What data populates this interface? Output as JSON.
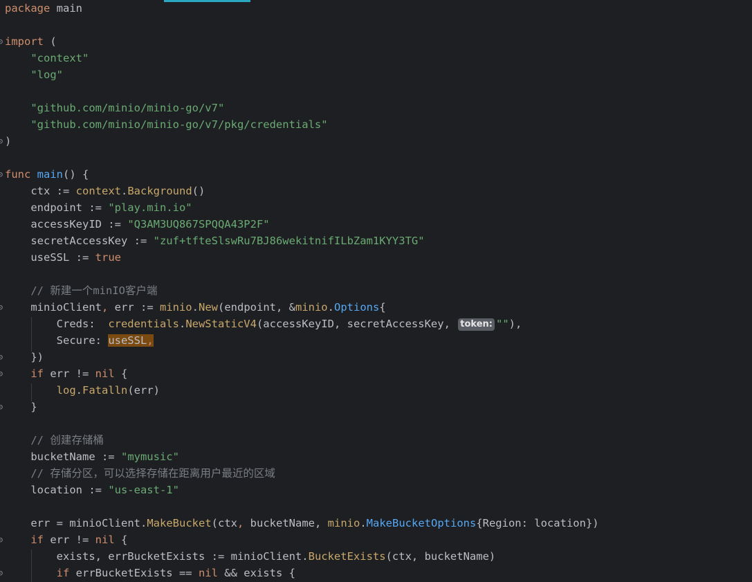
{
  "editor": {
    "lines": [
      [
        {
          "t": "package",
          "c": "kw"
        },
        {
          "t": " main",
          "c": "plain"
        }
      ],
      [],
      [
        {
          "t": "import",
          "c": "kw"
        },
        {
          "t": " (",
          "c": "plain"
        }
      ],
      [
        {
          "t": "    ",
          "c": "plain"
        },
        {
          "t": "\"context\"",
          "c": "str"
        }
      ],
      [
        {
          "t": "    ",
          "c": "plain"
        },
        {
          "t": "\"log\"",
          "c": "str"
        }
      ],
      [],
      [
        {
          "t": "    ",
          "c": "plain"
        },
        {
          "t": "\"github.com/minio/minio-go/v7\"",
          "c": "str"
        }
      ],
      [
        {
          "t": "    ",
          "c": "plain"
        },
        {
          "t": "\"github.com/minio/minio-go/v7/pkg/credentials\"",
          "c": "str"
        }
      ],
      [
        {
          "t": ")",
          "c": "plain"
        }
      ],
      [],
      [
        {
          "t": "func",
          "c": "kw"
        },
        {
          "t": " ",
          "c": "plain"
        },
        {
          "t": "main",
          "c": "fn"
        },
        {
          "t": "() {",
          "c": "plain"
        }
      ],
      [
        {
          "t": "    ctx := ",
          "c": "plain"
        },
        {
          "t": "context",
          "c": "pkgc"
        },
        {
          "t": ".",
          "c": "plain"
        },
        {
          "t": "Background",
          "c": "pkgc"
        },
        {
          "t": "()",
          "c": "plain"
        }
      ],
      [
        {
          "t": "    endpoint := ",
          "c": "plain"
        },
        {
          "t": "\"play.min.io\"",
          "c": "str"
        }
      ],
      [
        {
          "t": "    accessKeyID := ",
          "c": "plain"
        },
        {
          "t": "\"Q3AM3UQ867SPQQA43P2F\"",
          "c": "str"
        }
      ],
      [
        {
          "t": "    secretAccessKey := ",
          "c": "plain"
        },
        {
          "t": "\"zuf+tfteSlswRu7BJ86wekitnifILbZam1KYY3TG\"",
          "c": "str"
        }
      ],
      [
        {
          "t": "    useSSL := ",
          "c": "plain"
        },
        {
          "t": "true",
          "c": "kw"
        }
      ],
      [],
      [
        {
          "t": "    ",
          "c": "plain"
        },
        {
          "t": "// 新建一个minIO客户端",
          "c": "cmt"
        }
      ],
      [
        {
          "t": "    minioClient",
          "c": "plain"
        },
        {
          "t": ",",
          "c": "kw"
        },
        {
          "t": " err := ",
          "c": "plain"
        },
        {
          "t": "minio",
          "c": "pkgc"
        },
        {
          "t": ".",
          "c": "plain"
        },
        {
          "t": "New",
          "c": "pkgc"
        },
        {
          "t": "(endpoint, &",
          "c": "plain"
        },
        {
          "t": "minio",
          "c": "pkgc"
        },
        {
          "t": ".",
          "c": "plain"
        },
        {
          "t": "Options",
          "c": "typ"
        },
        {
          "t": "{",
          "c": "plain"
        }
      ],
      [
        {
          "t": "        Creds:  ",
          "c": "plain"
        },
        {
          "t": "credentials",
          "c": "pkgc"
        },
        {
          "t": ".",
          "c": "plain"
        },
        {
          "t": "NewStaticV4",
          "c": "pkgc"
        },
        {
          "t": "(accessKeyID, secretAccessKey, ",
          "c": "plain"
        },
        {
          "hint": "token:"
        },
        {
          "t": "\"\"",
          "c": "str"
        },
        {
          "t": "),",
          "c": "plain"
        }
      ],
      [
        {
          "t": "        Secure: ",
          "c": "plain"
        },
        {
          "t": "useSSL",
          "c": "plain",
          "hl": true
        },
        {
          "t": ",",
          "c": "kw",
          "hl": true
        }
      ],
      [
        {
          "t": "    })",
          "c": "plain"
        }
      ],
      [
        {
          "t": "    ",
          "c": "plain"
        },
        {
          "t": "if",
          "c": "kw"
        },
        {
          "t": " err != ",
          "c": "plain"
        },
        {
          "t": "nil",
          "c": "kw"
        },
        {
          "t": " {",
          "c": "plain"
        }
      ],
      [
        {
          "t": "        ",
          "c": "plain"
        },
        {
          "t": "log",
          "c": "pkgc"
        },
        {
          "t": ".",
          "c": "plain"
        },
        {
          "t": "Fatalln",
          "c": "pkgc"
        },
        {
          "t": "(err)",
          "c": "plain"
        }
      ],
      [
        {
          "t": "    }",
          "c": "plain"
        }
      ],
      [],
      [
        {
          "t": "    ",
          "c": "plain"
        },
        {
          "t": "// 创建存储桶",
          "c": "cmt"
        }
      ],
      [
        {
          "t": "    bucketName := ",
          "c": "plain"
        },
        {
          "t": "\"mymusic\"",
          "c": "str"
        }
      ],
      [
        {
          "t": "    ",
          "c": "plain"
        },
        {
          "t": "// 存储分区，可以选择存储在距离用户最近的区域",
          "c": "cmt"
        }
      ],
      [
        {
          "t": "    location := ",
          "c": "plain"
        },
        {
          "t": "\"us-east-1\"",
          "c": "str"
        }
      ],
      [],
      [
        {
          "t": "    err = ",
          "c": "plain"
        },
        {
          "t": "minioClient",
          "c": "plain"
        },
        {
          "t": ".",
          "c": "plain"
        },
        {
          "t": "MakeBucket",
          "c": "pkgc"
        },
        {
          "t": "(ctx",
          "c": "plain"
        },
        {
          "t": ",",
          "c": "kw"
        },
        {
          "t": " bucketName, ",
          "c": "plain"
        },
        {
          "t": "minio",
          "c": "pkgc"
        },
        {
          "t": ".",
          "c": "plain"
        },
        {
          "t": "MakeBucketOptions",
          "c": "typ"
        },
        {
          "t": "{Region: location})",
          "c": "plain"
        }
      ],
      [
        {
          "t": "    ",
          "c": "plain"
        },
        {
          "t": "if",
          "c": "kw"
        },
        {
          "t": " err != ",
          "c": "plain"
        },
        {
          "t": "nil",
          "c": "kw"
        },
        {
          "t": " {",
          "c": "plain"
        }
      ],
      [
        {
          "t": "        exists, errBucketExists := minioClient.",
          "c": "plain"
        },
        {
          "t": "BucketExists",
          "c": "pkgc"
        },
        {
          "t": "(ctx, bucketName)",
          "c": "plain"
        }
      ],
      [
        {
          "t": "        ",
          "c": "plain"
        },
        {
          "t": "if",
          "c": "kw"
        },
        {
          "t": " errBucketExists == ",
          "c": "plain"
        },
        {
          "t": "nil",
          "c": "kw"
        },
        {
          "t": " && exists {",
          "c": "plain"
        }
      ]
    ],
    "fold_markers": [
      2,
      8,
      10,
      18,
      21,
      22,
      24,
      32,
      34
    ]
  }
}
